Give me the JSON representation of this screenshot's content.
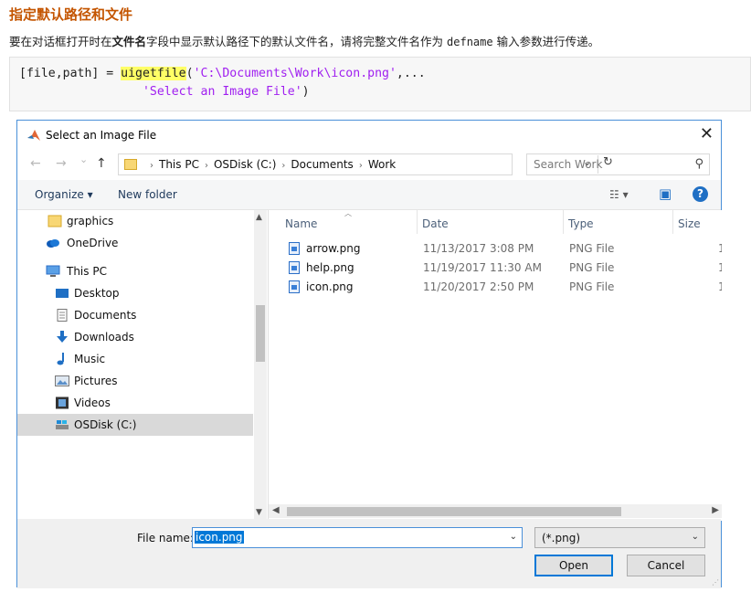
{
  "doc": {
    "heading": "指定默认路径和文件",
    "para_before": "要在对话框打开时在",
    "para_bold": "文件名",
    "para_mid": "字段中显示默认路径下的默认文件名，请将完整文件名作为 ",
    "para_code": "defname",
    "para_after": " 输入参数进行传递。",
    "code_l1_a": "[file,path] = ",
    "code_l1_fn": "uigetfile",
    "code_l1_b": "(",
    "code_l1_str": "'C:\\Documents\\Work\\icon.png'",
    "code_l1_c": ",...",
    "code_l2_pad": "                 ",
    "code_l2_str": "'Select an Image File'",
    "code_l2_c": ")"
  },
  "dialog": {
    "title": "Select an Image File",
    "close": "✕",
    "nav_back": "←",
    "nav_forward": "→",
    "nav_recent": "⌄",
    "nav_up": "↑",
    "breadcrumb": [
      "This PC",
      "OSDisk (C:)",
      "Documents",
      "Work"
    ],
    "crumb_sep": "›",
    "refresh": "↻",
    "search_placeholder": "Search Work",
    "search_icon": "⚲",
    "toolbar": {
      "organize": "Organize ▾",
      "new_folder": "New folder",
      "view": "☷ ▾",
      "pane": "▣",
      "help": "?"
    },
    "nav_items": [
      {
        "label": "graphics",
        "icon": "folder-icon"
      },
      {
        "label": "OneDrive",
        "icon": "cloud-icon"
      },
      {
        "label": "This PC",
        "icon": "computer-icon"
      },
      {
        "label": "Desktop",
        "icon": "desktop-icon"
      },
      {
        "label": "Documents",
        "icon": "documents-icon"
      },
      {
        "label": "Downloads",
        "icon": "download-icon"
      },
      {
        "label": "Music",
        "icon": "music-icon"
      },
      {
        "label": "Pictures",
        "icon": "pictures-icon"
      },
      {
        "label": "Videos",
        "icon": "videos-icon"
      },
      {
        "label": "OSDisk (C:)",
        "icon": "drive-icon",
        "selected": true
      }
    ],
    "columns": [
      "Name",
      "Date",
      "Type",
      "Size"
    ],
    "files": [
      {
        "name": "arrow.png",
        "date": "11/13/2017 3:08 PM",
        "type": "PNG File",
        "size": "1"
      },
      {
        "name": "help.png",
        "date": "11/19/2017 11:30 AM",
        "type": "PNG File",
        "size": "1"
      },
      {
        "name": "icon.png",
        "date": "11/20/2017 2:50 PM",
        "type": "PNG File",
        "size": "1"
      }
    ],
    "file_name_label": "File name:",
    "file_name_value": "icon.png",
    "file_type": "(*.png)",
    "open_label": "Open",
    "cancel_label": "Cancel"
  }
}
